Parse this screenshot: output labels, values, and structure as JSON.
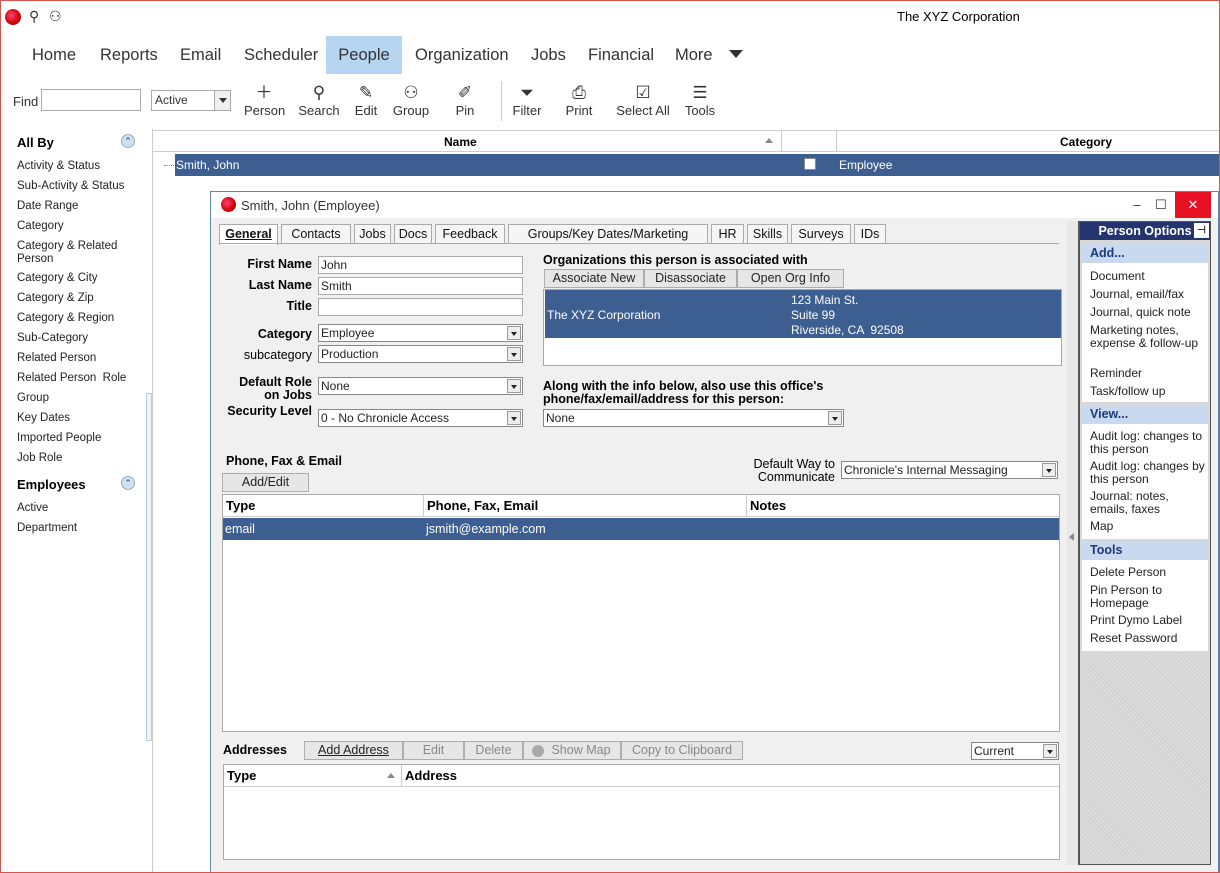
{
  "app": {
    "title": "The XYZ Corporation"
  },
  "menu": [
    "Home",
    "Reports",
    "Email",
    "Scheduler",
    "People",
    "Organization",
    "Jobs",
    "Financial",
    "More"
  ],
  "menu_active": "People",
  "toolbar": {
    "find_label": "Find",
    "status_select": "Active",
    "buttons": [
      {
        "label": "Person",
        "icon": "plus-icon"
      },
      {
        "label": "Search",
        "icon": "search-icon"
      },
      {
        "label": "Edit",
        "icon": "pencil-icon"
      },
      {
        "label": "Group",
        "icon": "group-icon"
      },
      {
        "label": "Pin",
        "icon": "pin-icon"
      },
      {
        "label": "Filter",
        "icon": "filter-icon"
      },
      {
        "label": "Print",
        "icon": "printer-icon"
      },
      {
        "label": "Select All",
        "icon": "checkbox-icon"
      },
      {
        "label": "Tools",
        "icon": "menu-icon"
      }
    ]
  },
  "sidebar": {
    "all_by": "All By",
    "items": [
      "Activity & Status",
      "Sub-Activity & Status",
      "Date Range",
      "Category",
      "Category & Related Person",
      "Category & City",
      "Category & Zip",
      "Category & Region",
      "Sub-Category",
      "Related Person",
      "Related Person  Role",
      "Group",
      "Key Dates",
      "Imported People",
      "Job Role"
    ],
    "employees": "Employees",
    "employee_items": [
      "Active",
      "Department"
    ]
  },
  "grid": {
    "columns": [
      "Name",
      "Category"
    ],
    "rows": [
      {
        "name": "Smith, John",
        "category": "Employee"
      }
    ]
  },
  "dialog": {
    "title": "Smith, John (Employee)",
    "tabs": [
      "General",
      "Contacts",
      "Jobs",
      "Docs",
      "Feedback",
      "Groups/Key Dates/Marketing",
      "HR",
      "Skills",
      "Surveys",
      "IDs"
    ],
    "fields": {
      "first_name_label": "First Name",
      "first_name": "John",
      "last_name_label": "Last Name",
      "last_name": "Smith",
      "title_label": "Title",
      "title": "",
      "category_label": "Category",
      "category": "Employee",
      "subcategory_label": "subcategory",
      "subcategory": "Production",
      "default_role_label": "Default Role on Jobs",
      "default_role": "None",
      "security_label": "Security Level",
      "security": "0 - No Chronicle Access"
    },
    "orgs": {
      "heading": "Organizations this person is associated with",
      "buttons": [
        "Associate New",
        "Disassociate",
        "Open Org Info"
      ],
      "name": "The XYZ Corporation",
      "addr1": "123 Main St.",
      "addr2": "Suite 99",
      "addr3": "Riverside, CA  92508"
    },
    "office": {
      "label": "Along with the info below, also use this office's phone/fax/email/address for this person:",
      "value": "None"
    },
    "phone": {
      "heading": "Phone, Fax & Email",
      "add_edit": "Add/Edit",
      "default_way_label": "Default Way to Communicate",
      "default_way": "Chronicle's Internal Messaging",
      "columns": [
        "Type",
        "Phone, Fax, Email",
        "Notes"
      ],
      "rows": [
        {
          "type": "email",
          "value": "jsmith@example.com",
          "notes": ""
        }
      ]
    },
    "addresses": {
      "heading": "Addresses",
      "buttons": [
        "Add Address",
        "Edit",
        "Delete",
        "Show Map",
        "Copy to Clipboard"
      ],
      "filter": "Current",
      "columns": [
        "Type",
        "Address"
      ]
    }
  },
  "options": {
    "title": "Person Options",
    "add_head": "Add...",
    "add_items": [
      "Document",
      "Journal, email/fax",
      "Journal, quick note",
      "Marketing notes, expense & follow-up",
      "Reminder",
      "Task/follow up"
    ],
    "view_head": "View...",
    "view_items": [
      "Audit log: changes to this person",
      "Audit log: changes by this person",
      "Journal: notes, emails, faxes",
      "Map"
    ],
    "tools_head": "Tools",
    "tools_items": [
      "Delete Person",
      "Pin Person to Homepage",
      "Print Dymo Label",
      "Reset Password"
    ]
  },
  "colors": {
    "selection": "#3d5e91",
    "accent": "#b5d5f0",
    "options_header": "#24346e"
  }
}
